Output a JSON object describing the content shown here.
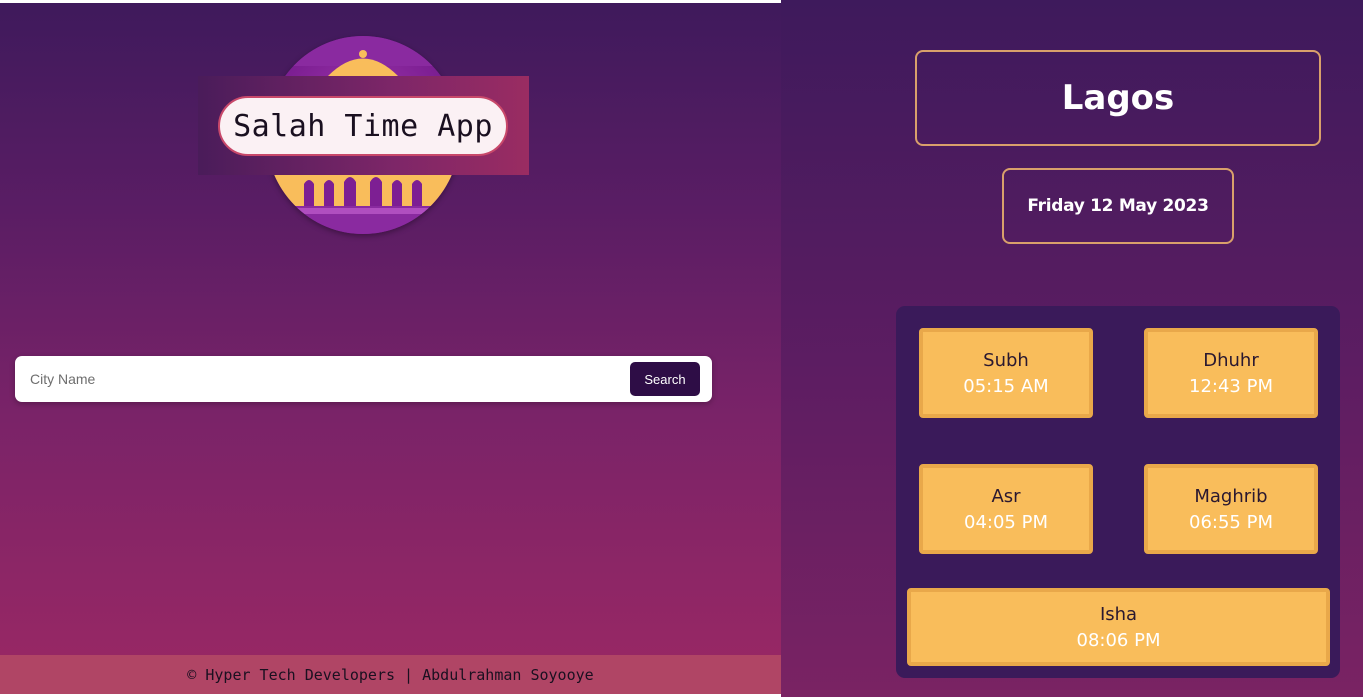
{
  "app": {
    "title": "Salah Time App"
  },
  "search": {
    "placeholder": "City Name",
    "button_label": "Search"
  },
  "footer": {
    "text": "© Hyper Tech Developers | Abdulrahman Soyooye"
  },
  "result": {
    "city": "Lagos",
    "date": "Friday 12 May 2023",
    "prayers": [
      {
        "name": "Subh",
        "time": "05:15 AM"
      },
      {
        "name": "Dhuhr",
        "time": "12:43 PM"
      },
      {
        "name": "Asr",
        "time": "04:05 PM"
      },
      {
        "name": "Maghrib",
        "time": "06:55 PM"
      },
      {
        "name": "Isha",
        "time": "08:06 PM"
      }
    ]
  },
  "colors": {
    "accent_gold": "#f9bd5b",
    "button_dark": "#2e0d46",
    "footer_pink": "#b04565",
    "box_border": "#d9a06b"
  }
}
